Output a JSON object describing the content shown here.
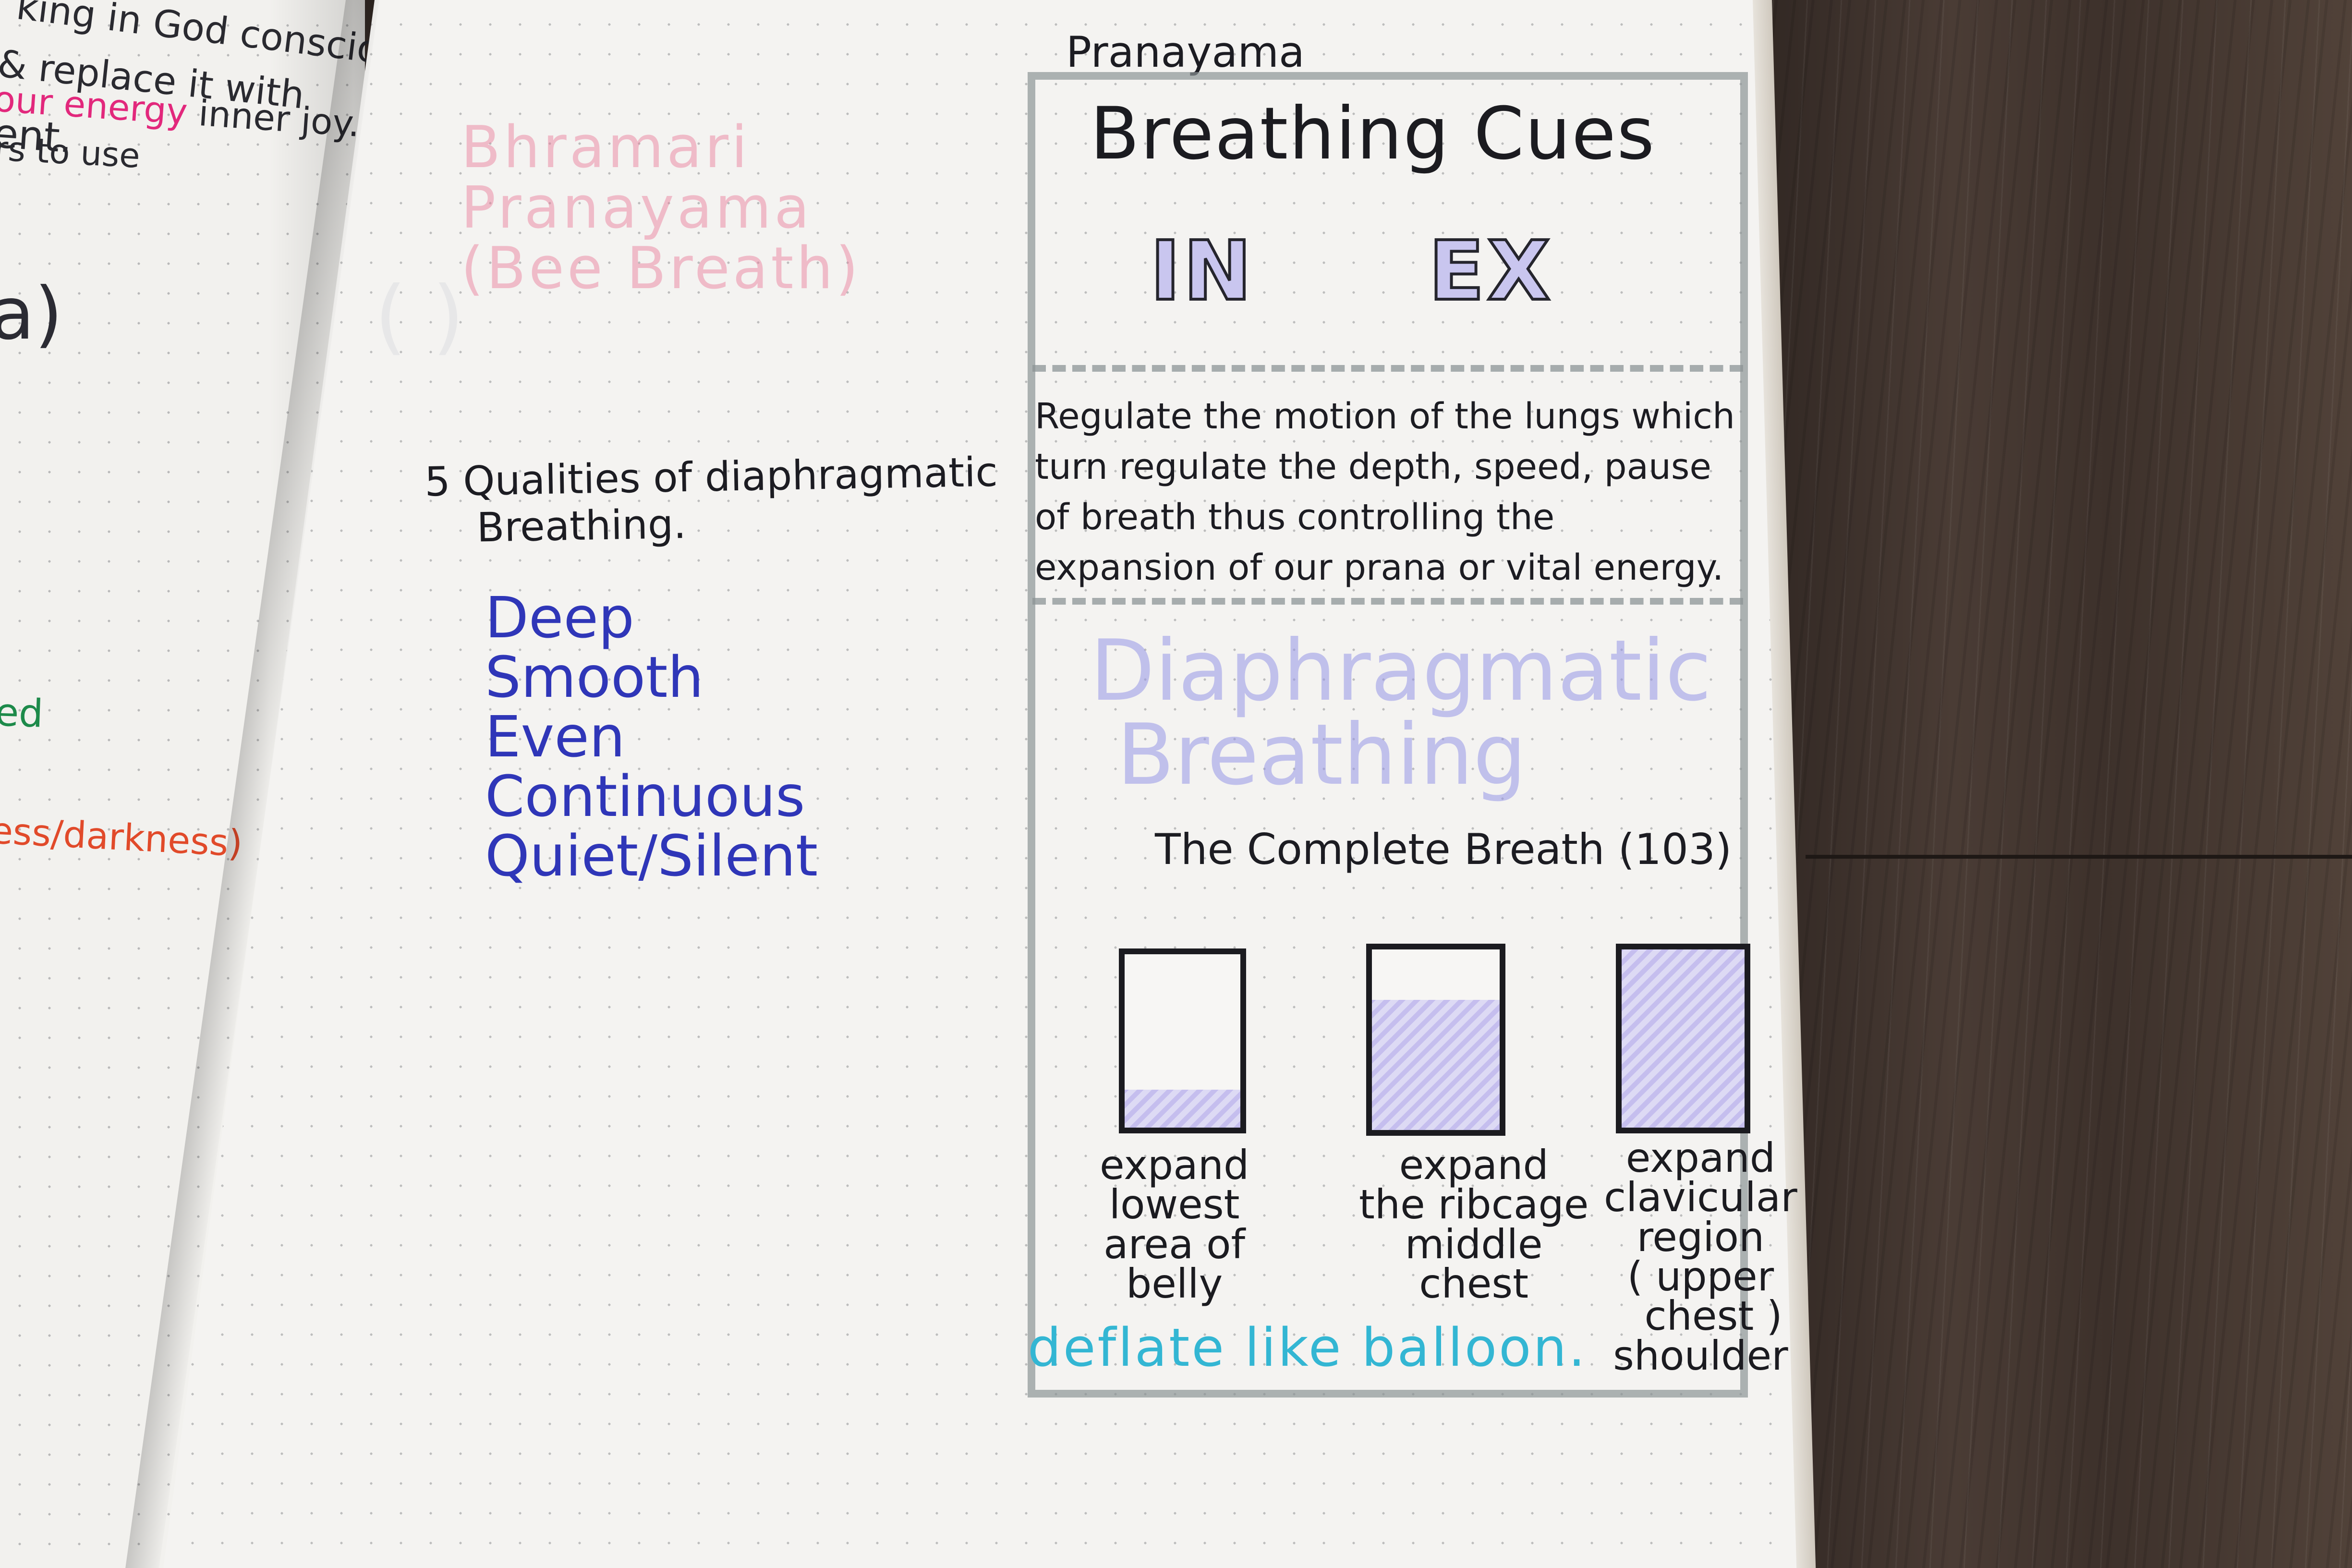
{
  "left_page": {
    "line1": "king in God consciousness",
    "line2": "& replace it with",
    "line3_a": "our energy",
    "line3_b": " inner joy.",
    "line3_prefix": "ent.",
    "line4": "rs to use",
    "big_fragment": "a)",
    "green_fragment": "ed",
    "orange_fragment": "ess/darkness)"
  },
  "bhramari": {
    "line1": "Bhramari",
    "line2": "Pranayama",
    "line3": "(Bee Breath)"
  },
  "qualities": {
    "title_line1": "5 Qualities of diaphragmatic",
    "title_line2": "Breathing.",
    "items": [
      "Deep",
      "Smooth",
      "Even",
      "Continuous",
      "Quiet/Silent"
    ]
  },
  "pranayama": {
    "label": "Pranayama",
    "cues_title": "Breathing Cues",
    "in_label": "IN",
    "ex_label": "EX",
    "regulate_line1": "Regulate the motion of the lungs which",
    "regulate_line2": "turn regulate the depth, speed, pause",
    "regulate_line3": "of breath thus controlling the",
    "regulate_line4": "expansion of our prana or vital energy.",
    "diaph_line1": "Diaphragmatic",
    "diaph_line2": "Breathing",
    "complete_breath": "The Complete Breath (103)",
    "stages": [
      {
        "caption": "expand\nlowest\narea of\nbelly",
        "fill_fraction": 0.22
      },
      {
        "caption": "expand\nthe ribcage\nmiddle\nchest",
        "fill_fraction": 0.72
      },
      {
        "caption": "expand\nclavicular\nregion\n( upper\n  chest )\nshoulder",
        "fill_fraction": 1.0
      }
    ],
    "deflate": "deflate like balloon."
  }
}
